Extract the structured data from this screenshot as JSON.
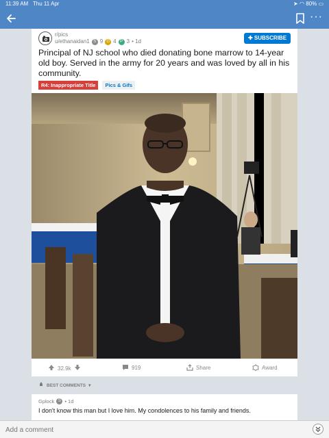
{
  "statusbar": {
    "time": "11:39 AM",
    "date": "Thu 11 Apr",
    "battery": "80%"
  },
  "post": {
    "subreddit": "r/pics",
    "author": "u/ethanaidan1",
    "awards": [
      {
        "type": "silver",
        "count": "9"
      },
      {
        "type": "gold",
        "count": "4"
      },
      {
        "type": "platinum",
        "count": "3"
      }
    ],
    "age": "• 1d",
    "subscribe_label": "SUBSCRIBE",
    "title": "Principal of NJ school who died donating bone marrow to 14-year old boy. Served in the army for 20 years and was loved by all in his community.",
    "flair_mod": "R4: Inappropriate Title",
    "flair_type": "Pics & Gifs"
  },
  "actions": {
    "score": "32.9k",
    "comments": "919",
    "share": "Share",
    "award": "Award"
  },
  "comments_section": {
    "sort_label": "BEST COMMENTS"
  },
  "comment": {
    "author": "Gplock",
    "age": "• 1d",
    "body": "I don't know this man but I love him. My condolences to his family and friends."
  },
  "composer": {
    "placeholder": "Add a comment"
  },
  "colors": {
    "header_blue": "#4f86c6",
    "subscribe_blue": "#0079d3",
    "mod_flair_red": "#d93f3a"
  }
}
